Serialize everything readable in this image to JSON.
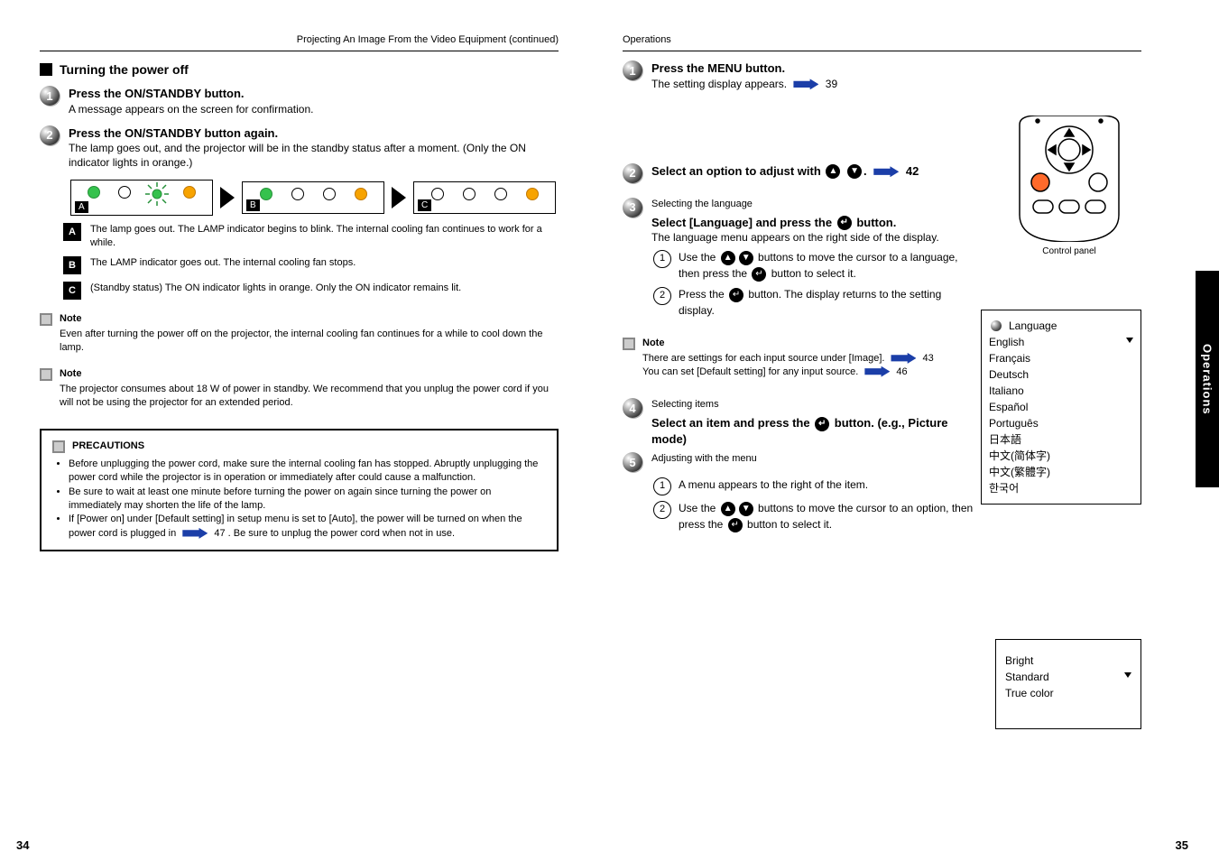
{
  "header_left": "Projecting An Image From the Video Equipment (continued)",
  "header_right": "Operations",
  "side_tab": "Operations",
  "page_left": "34",
  "page_right": "35",
  "left": {
    "section_title": "Turning the power off",
    "step1": {
      "lead": "Press the ON/STANDBY button.",
      "desc": "A message appears on the screen for confirmation."
    },
    "step2": {
      "lead": "Press the ON/STANDBY button again.",
      "desc": "The lamp goes out, and the projector will be in the standby status after a moment. (Only the ON indicator lights in orange.)"
    },
    "panels": {
      "a": {
        "cap": "A",
        "desc_title": "",
        "desc": "The lamp goes out. The LAMP indicator begins to blink. The internal cooling fan continues to work for a while."
      },
      "b": {
        "cap": "B",
        "desc_title": "",
        "desc": "The LAMP indicator goes out. The internal cooling fan stops."
      },
      "c": {
        "cap": "C",
        "desc_title": "",
        "desc": "(Standby status) The ON indicator lights in orange. Only the ON indicator remains lit."
      }
    },
    "note1": {
      "title": "Note",
      "body": "Even after turning the power off on the projector, the internal cooling fan continues for a while to cool down the lamp."
    },
    "note2": {
      "title": "Note",
      "body": "The projector consumes about 18 W of power in standby. We recommend that you unplug the power cord if you will not be using the projector for an extended period."
    },
    "caution": {
      "title": "PRECAUTIONS",
      "items": [
        "Before unplugging the power cord, make sure the internal cooling fan has stopped. Abruptly unplugging the power cord while the projector is in operation or immediately after could cause a malfunction.",
        "Be sure to wait at least one minute before turning the power on again since turning the power on immediately may shorten the life of the lamp.",
        "If [Power on] under [Default setting] in setup menu is set to [Auto], the power will be turned on when the power cord is plugged in "
      ],
      "tail": ". Be sure to unplug the power cord when not in use.",
      "ref": "47"
    }
  },
  "right": {
    "step1": {
      "lead": "Press the MENU button.",
      "desc": "The setting display appears. ",
      "ref": "39",
      "img_caption": "Control panel"
    },
    "step2": {
      "lead": "Select an option to adjust with ",
      "ref": "42"
    },
    "step3": {
      "title": "Selecting the language",
      "lead": "Select [Language] and press the  button.",
      "desc": "The language menu appears on the right side of the display.",
      "sub1": "Use the  buttons to move the cursor to a language, then press the  button to select it.",
      "sub2": "Press the  button. The display returns to the setting display.",
      "languages": [
        "English",
        "Français",
        "Deutsch",
        "Italiano",
        "Español",
        "Português",
        "日本語",
        "中文(简体字)",
        "中文(繁體字)",
        "한국어"
      ],
      "lang_selected": "English",
      "lang_title": "Language"
    },
    "note": {
      "title": "Note",
      "line1": "There are settings for each input source under [Image]. ",
      "ref1": "43",
      "line2": "You can set [Default setting] for any input source. ",
      "ref2": "46"
    },
    "step4": {
      "title": "Selecting items",
      "lead": "Select an item and press the  button.",
      "selected": "Picture mode"
    },
    "step5": {
      "title": "Adjusting with the menu",
      "sub1": "A menu appears to the right of the item.",
      "sub2": "Use the  buttons to move the cursor to an option, then press the  button to select it.",
      "options": [
        "Bright",
        "Standard",
        "True color"
      ]
    }
  }
}
